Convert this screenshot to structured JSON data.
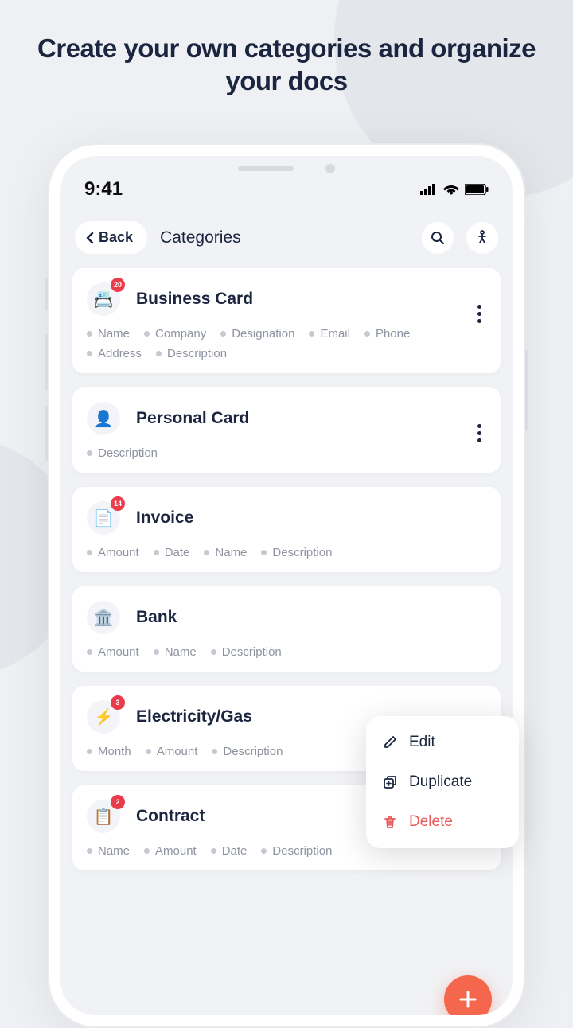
{
  "headline": "Create your own categories and organize your docs",
  "status": {
    "time": "9:41"
  },
  "header": {
    "back_label": "Back",
    "title": "Categories"
  },
  "categories": [
    {
      "title": "Business Card",
      "badge": "20",
      "icon_glyph": "📇",
      "fields": [
        "Name",
        "Company",
        "Designation",
        "Email",
        "Phone",
        "Address",
        "Description"
      ],
      "show_more": true
    },
    {
      "title": "Personal Card",
      "badge": null,
      "icon_glyph": "👤",
      "fields": [
        "Description"
      ],
      "show_more": true
    },
    {
      "title": "Invoice",
      "badge": "14",
      "icon_glyph": "📄",
      "fields": [
        "Amount",
        "Date",
        "Name",
        "Description"
      ],
      "show_more": false
    },
    {
      "title": "Bank",
      "badge": null,
      "icon_glyph": "🏛️",
      "fields": [
        "Amount",
        "Name",
        "Description"
      ],
      "show_more": false
    },
    {
      "title": "Electricity/Gas",
      "badge": "3",
      "icon_glyph": "⚡",
      "fields": [
        "Month",
        "Amount",
        "Description"
      ],
      "show_more": true
    },
    {
      "title": "Contract",
      "badge": "2",
      "icon_glyph": "📋",
      "fields": [
        "Name",
        "Amount",
        "Date",
        "Description"
      ],
      "show_more": true
    }
  ],
  "context_menu": {
    "edit": "Edit",
    "duplicate": "Duplicate",
    "delete": "Delete"
  }
}
